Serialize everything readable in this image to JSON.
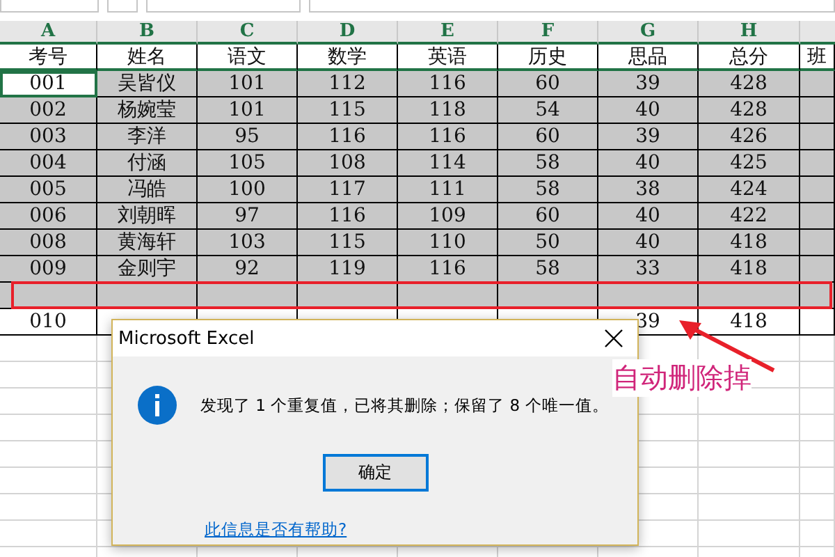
{
  "columns": [
    "A",
    "B",
    "C",
    "D",
    "E",
    "F",
    "G",
    "H"
  ],
  "table": {
    "header": [
      "考号",
      "姓名",
      "语文",
      "数学",
      "英语",
      "历史",
      "思品",
      "总分",
      "班"
    ],
    "rows": [
      {
        "cells": [
          "001",
          "吴皆仪",
          "101",
          "112",
          "116",
          "60",
          "39",
          "428"
        ],
        "selected": true,
        "active": true
      },
      {
        "cells": [
          "002",
          "杨婉莹",
          "101",
          "115",
          "118",
          "54",
          "40",
          "428"
        ],
        "selected": true,
        "active": false
      },
      {
        "cells": [
          "003",
          "李洋",
          "95",
          "116",
          "116",
          "60",
          "39",
          "426"
        ],
        "selected": true,
        "active": false
      },
      {
        "cells": [
          "004",
          "付涵",
          "105",
          "108",
          "114",
          "58",
          "40",
          "425"
        ],
        "selected": true,
        "active": false
      },
      {
        "cells": [
          "005",
          "冯皓",
          "100",
          "117",
          "111",
          "58",
          "38",
          "424"
        ],
        "selected": true,
        "active": false
      },
      {
        "cells": [
          "006",
          "刘朝晖",
          "97",
          "116",
          "109",
          "60",
          "40",
          "422"
        ],
        "selected": true,
        "active": false
      },
      {
        "cells": [
          "008",
          "黄海轩",
          "103",
          "115",
          "110",
          "50",
          "40",
          "418"
        ],
        "selected": true,
        "active": false
      },
      {
        "cells": [
          "009",
          "金则宇",
          "92",
          "119",
          "116",
          "58",
          "33",
          "418"
        ],
        "selected": true,
        "active": false
      },
      {
        "cells": [
          null,
          null,
          null,
          null,
          null,
          null,
          null,
          null
        ],
        "selected": true,
        "active": false,
        "highlighted": true
      },
      {
        "cells": [
          "010",
          null,
          null,
          null,
          null,
          null,
          "39",
          "418"
        ],
        "selected": false,
        "active": false
      }
    ]
  },
  "dialog": {
    "title": "Microsoft Excel",
    "message": "发现了 1 个重复值，已将其删除；保留了 8 个唯一值。",
    "button": "确定",
    "help_link": "此信息是否有帮助?"
  },
  "annotation": "自动删除掉"
}
